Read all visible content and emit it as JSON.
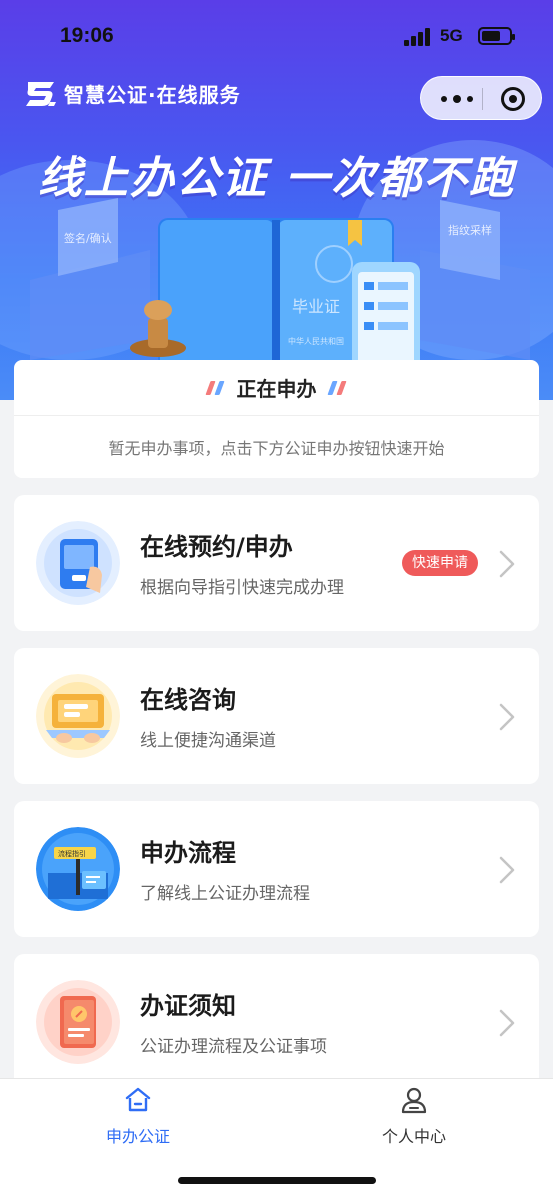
{
  "status_bar": {
    "time": "19:06",
    "network": "5G"
  },
  "header": {
    "brand_title": "智慧公证·在线服务"
  },
  "hero": {
    "slogan": "线上办公证  一次都不跑",
    "book_text": "毕业证",
    "book_subtext": "中华人民共和国",
    "stand_left": "签名/确认",
    "stand_right": "指纹采样"
  },
  "in_progress": {
    "title": "正在申办",
    "empty_text": "暂无申办事项，点击下方公证申办按钮快速开始"
  },
  "services": [
    {
      "title": "在线预约/申办",
      "desc": "根据向导指引快速完成办理",
      "badge": "快速申请",
      "icon": "phone-form-icon"
    },
    {
      "title": "在线咨询",
      "desc": "线上便捷沟通渠道",
      "icon": "laptop-chat-icon"
    },
    {
      "title": "申办流程",
      "desc": "了解线上公证办理流程",
      "icon": "signpost-icon",
      "icon_label": "流程指引"
    },
    {
      "title": "办证须知",
      "desc": "公证办理流程及公证事项",
      "icon": "notice-book-icon"
    }
  ],
  "tabbar": {
    "tabs": [
      {
        "label": "申办公证",
        "active": true,
        "icon": "home-icon"
      },
      {
        "label": "个人中心",
        "active": false,
        "icon": "user-icon"
      }
    ]
  },
  "colors": {
    "accent": "#2f6df5",
    "badge": "#ef5a5a",
    "hero_top": "#5a3ee8",
    "hero_bottom": "#4b8cf7"
  }
}
